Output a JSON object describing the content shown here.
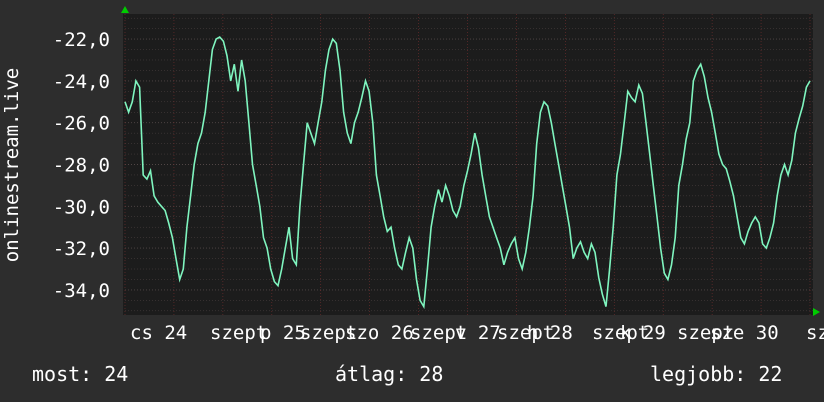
{
  "chart_data": {
    "type": "line",
    "ylabel": "onlinestream.live",
    "ylim": [
      -35.2,
      -20.8
    ],
    "y_ticks": [
      -22,
      -24,
      -26,
      -28,
      -30,
      -32,
      -34
    ],
    "y_tick_labels": [
      "-22,0",
      "-24,0",
      "-26,0",
      "-28,0",
      "-30,0",
      "-32,0",
      "-34,0"
    ],
    "x_tick_labels": [
      "cs 24",
      "szept",
      "p 25",
      "szept",
      "szo 26",
      "szept",
      "v 27",
      "szept",
      "h 28",
      "szept",
      "k 29",
      "szept",
      "sze 30",
      "sze"
    ],
    "grid": true,
    "series": [
      {
        "values": [
          -25,
          -25.5,
          -25,
          -24,
          -24.3,
          -28.5,
          -28.7,
          -28.3,
          -29.5,
          -29.8,
          -30,
          -30.2,
          -30.8,
          -31.5,
          -32.5,
          -33.5,
          -33,
          -31,
          -29.5,
          -28,
          -27,
          -26.5,
          -25.5,
          -24,
          -22.5,
          -22,
          -21.9,
          -22.1,
          -22.8,
          -24,
          -23.2,
          -24.5,
          -23,
          -24,
          -26,
          -28,
          -29,
          -30,
          -31.5,
          -32,
          -33,
          -33.6,
          -33.8,
          -33,
          -32,
          -31,
          -32.5,
          -32.8,
          -30,
          -28,
          -26,
          -26.5,
          -27,
          -26,
          -25,
          -23.5,
          -22.5,
          -22,
          -22.2,
          -23.5,
          -25.5,
          -26.5,
          -27,
          -26,
          -25.5,
          -24.8,
          -24,
          -24.5,
          -26,
          -28.5,
          -29.5,
          -30.5,
          -31.2,
          -31,
          -32,
          -32.8,
          -33,
          -32.2,
          -31.5,
          -32,
          -33.5,
          -34.5,
          -34.8,
          -33,
          -31,
          -30,
          -29.2,
          -29.8,
          -29,
          -29.5,
          -30.2,
          -30.5,
          -30,
          -29,
          -28.3,
          -27.5,
          -26.5,
          -27.2,
          -28.5,
          -29.5,
          -30.5,
          -31,
          -31.5,
          -32,
          -32.8,
          -32.2,
          -31.8,
          -31.5,
          -32.5,
          -33,
          -32.2,
          -31,
          -29.5,
          -27,
          -25.5,
          -25,
          -25.2,
          -26,
          -27,
          -28,
          -29,
          -30,
          -31,
          -32.5,
          -32,
          -31.7,
          -32.2,
          -32.5,
          -31.8,
          -32.2,
          -33.4,
          -34.2,
          -34.8,
          -33,
          -31,
          -28.5,
          -27.5,
          -26,
          -24.5,
          -24.8,
          -25,
          -24.2,
          -24.6,
          -26,
          -27.5,
          -29,
          -30.5,
          -32,
          -33.2,
          -33.5,
          -32.8,
          -31.5,
          -29,
          -28,
          -26.8,
          -26,
          -24,
          -23.5,
          -23.2,
          -23.8,
          -24.8,
          -25.5,
          -26.5,
          -27.5,
          -28,
          -28.2,
          -28.8,
          -29.5,
          -30.5,
          -31.5,
          -31.8,
          -31.2,
          -30.8,
          -30.5,
          -30.8,
          -31.8,
          -32,
          -31.5,
          -30.8,
          -29.5,
          -28.5,
          -28,
          -28.5,
          -27.8,
          -26.5,
          -25.8,
          -25.2,
          -24.3,
          -24
        ]
      }
    ]
  },
  "footer": {
    "current": "most: 24",
    "average": "átlag: 28",
    "best": "legjobb: 22"
  },
  "colors": {
    "background": "#2d2d2d",
    "plot_background": "#1c1c1c",
    "line": "#7ff5bf",
    "grid": "#514646",
    "text": "#ffffff",
    "axis_arrow": "#00cc00"
  }
}
